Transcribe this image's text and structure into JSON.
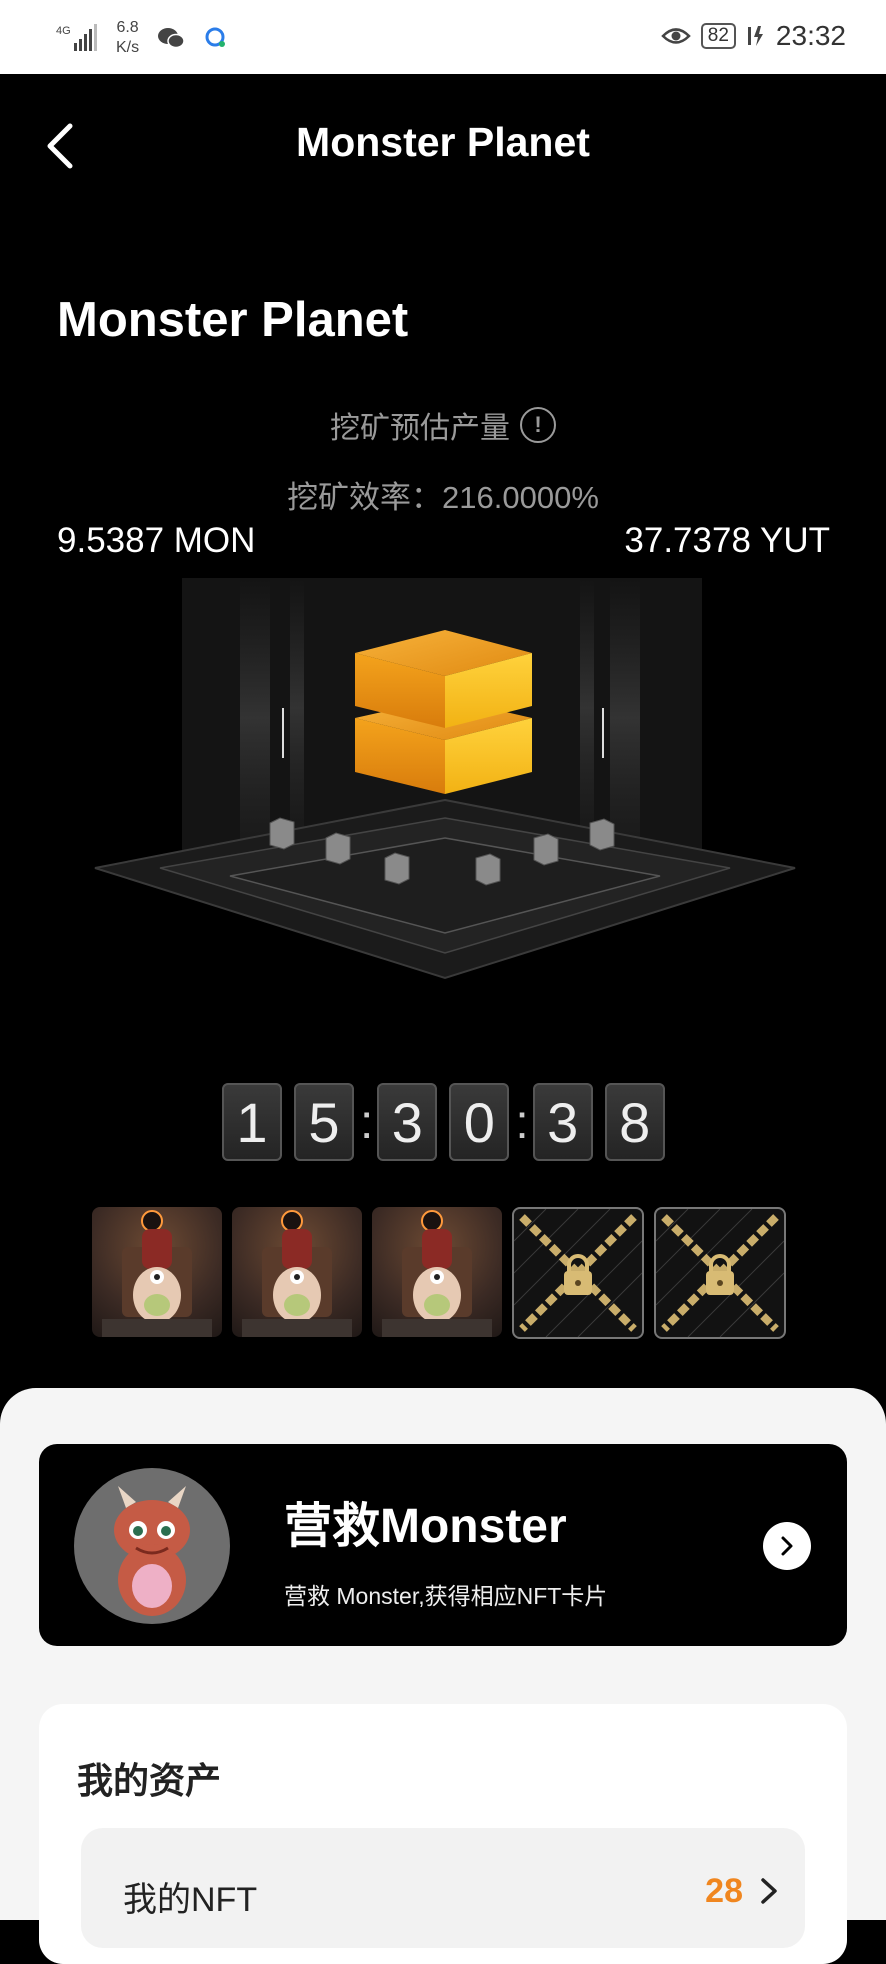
{
  "status_bar": {
    "network": "4G",
    "speed_value": "6.8",
    "speed_unit": "K/s",
    "battery": "82",
    "time": "23:32",
    "icons": [
      "signal-icon",
      "wechat-icon",
      "chat-bubble-icon",
      "eye-icon",
      "battery-icon",
      "charging-icon"
    ]
  },
  "navbar": {
    "title": "Monster Planet"
  },
  "hero": {
    "title": "Monster Planet",
    "estimate_label": "挖矿预估产量",
    "efficiency": "挖矿效率：216.0000%",
    "mon_value": "9.5387 MON",
    "yut_value": "37.7378 YUT"
  },
  "timer": {
    "digits": [
      "1",
      "5",
      "3",
      "0",
      "3",
      "8"
    ],
    "separator": ":"
  },
  "cards": {
    "states": [
      "monster",
      "monster",
      "monster",
      "locked",
      "locked"
    ]
  },
  "rescue": {
    "title": "营救Monster",
    "subtitle": "营救 Monster,获得相应NFT卡片"
  },
  "assets": {
    "title": "我的资产",
    "nft_label": "我的NFT",
    "nft_count": "28"
  },
  "colors": {
    "accent_orange": "#f0861f",
    "cube_orange": "#f3a21a",
    "background": "#000000"
  }
}
